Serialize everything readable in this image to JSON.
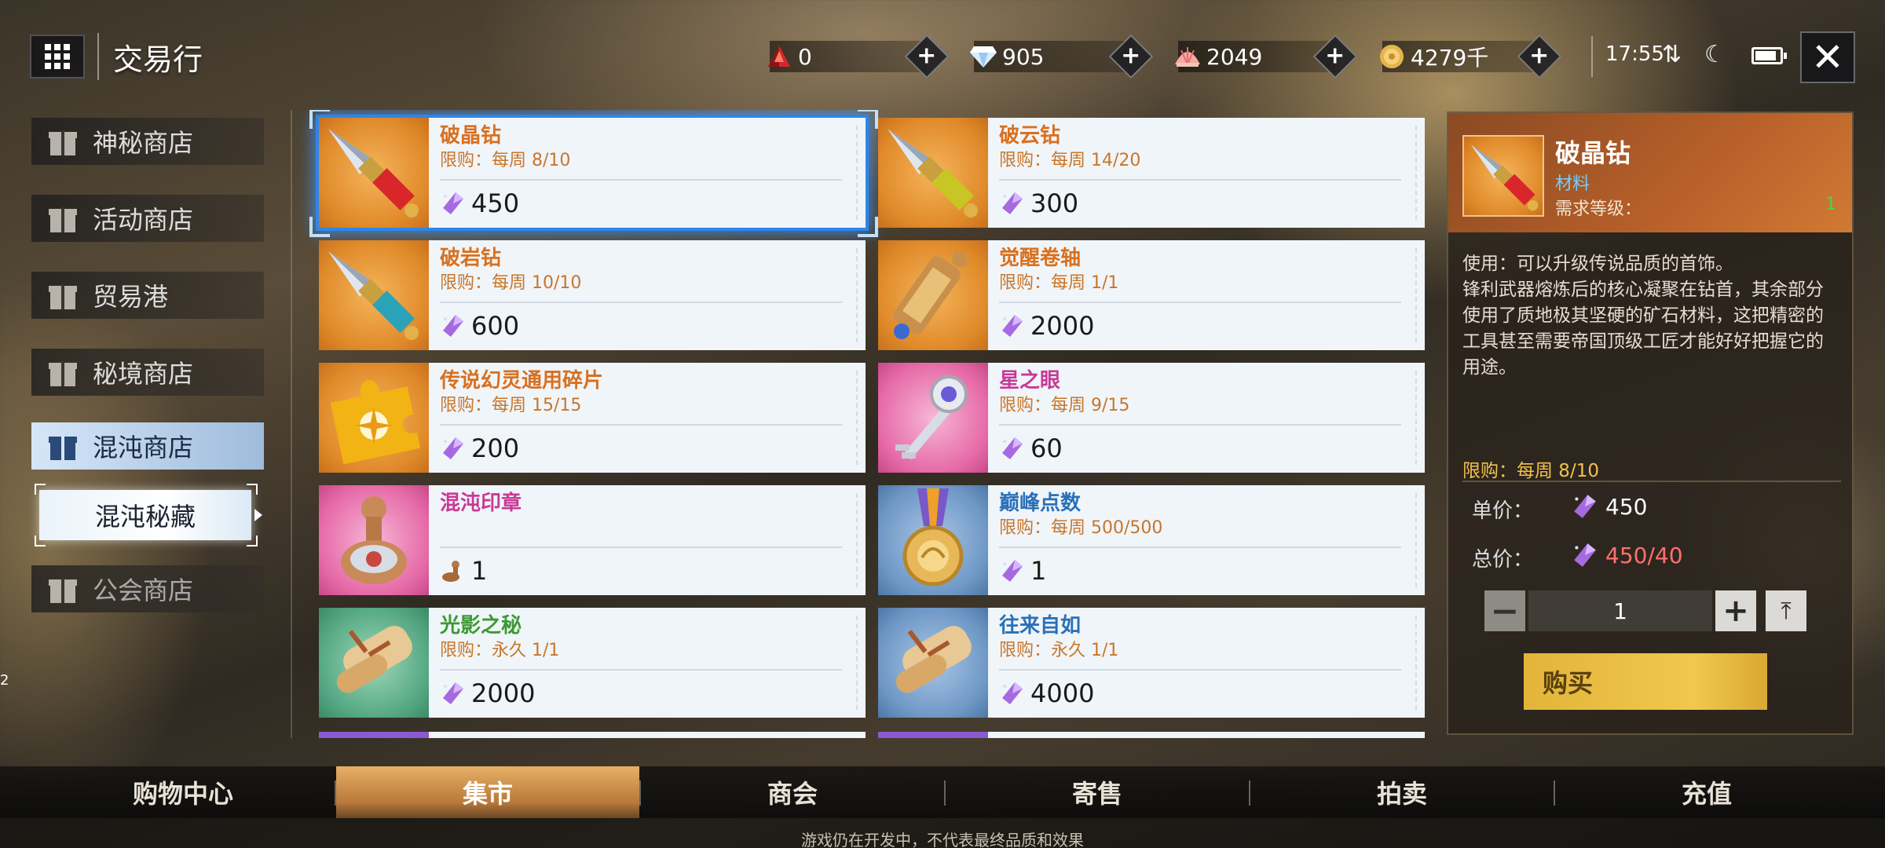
{
  "header": {
    "title": "交易行",
    "currencies": [
      {
        "icon": "red-crystal-icon",
        "value": "0"
      },
      {
        "icon": "diamond-icon",
        "value": "905"
      },
      {
        "icon": "shell-icon",
        "value": "2049"
      },
      {
        "icon": "gold-coin-icon",
        "value": "4279千"
      }
    ],
    "time": "17:55"
  },
  "left_menu": {
    "items": [
      {
        "label": "神秘商店"
      },
      {
        "label": "活动商店"
      },
      {
        "label": "贸易港"
      },
      {
        "label": "秘境商店"
      },
      {
        "label": "混沌商店"
      },
      {
        "label": "公会商店"
      }
    ],
    "sub_item": "混沌秘藏",
    "side_number": "2"
  },
  "items": [
    {
      "name": "破晶钻",
      "limit": "限购：每周 8/10",
      "price": "450",
      "name_color": "orange",
      "thumb": "drill-red"
    },
    {
      "name": "破云钻",
      "limit": "限购：每周 14/20",
      "price": "300",
      "name_color": "orange",
      "thumb": "drill-yellow"
    },
    {
      "name": "破岩钻",
      "limit": "限购：每周 10/10",
      "price": "600",
      "name_color": "orange",
      "thumb": "drill-cyan"
    },
    {
      "name": "觉醒卷轴",
      "limit": "限购：每周 1/1",
      "price": "2000",
      "name_color": "orange",
      "thumb": "scroll-gold"
    },
    {
      "name": "传说幻灵通用碎片",
      "limit": "限购：每周 15/15",
      "price": "200",
      "name_color": "orange",
      "thumb": "puzzle-piece"
    },
    {
      "name": "星之眼",
      "limit": "限购：每周 9/15",
      "price": "60",
      "name_color": "pink",
      "thumb": "key"
    },
    {
      "name": "混沌印章",
      "limit": "",
      "price": "1",
      "name_color": "pink",
      "thumb": "seal"
    },
    {
      "name": "巅峰点数",
      "limit": "限购：每周 500/500",
      "price": "1",
      "name_color": "blue",
      "thumb": "medal"
    },
    {
      "name": "光影之秘",
      "limit": "限购：永久 1/1",
      "price": "2000",
      "name_color": "green",
      "thumb": "scroll-green"
    },
    {
      "name": "往来自如",
      "limit": "限购：永久 1/1",
      "price": "4000",
      "name_color": "blue",
      "thumb": "scroll-blue"
    }
  ],
  "detail": {
    "name": "破晶钻",
    "category": "材料",
    "level_label": "需求等级：",
    "level": "1",
    "description": "使用：可以升级传说品质的首饰。\n锋利武器熔炼后的核心凝聚在钻首，其余部分使用了质地极其坚硬的矿石材料，这把精密的工具甚至需要帝国顶级工匠才能好好把握它的用途。",
    "limit": "限购：每周 8/10",
    "unit_price_label": "单价：",
    "unit_price": "450",
    "total_price_label": "总价：",
    "total_price": "450/40",
    "quantity": "1",
    "buy_label": "购买"
  },
  "bottom_tabs": [
    {
      "label": "购物中心"
    },
    {
      "label": "集市"
    },
    {
      "label": "商会"
    },
    {
      "label": "寄售"
    },
    {
      "label": "拍卖"
    },
    {
      "label": "充值"
    }
  ],
  "footer_note": "游戏仍在开发中，不代表最终品质和效果",
  "colors": {
    "accent_blue": "#2d86ea",
    "limit_orange": "#c8762a",
    "total_price_red": "#ff7070",
    "buy_gold": "#f0c84c"
  }
}
